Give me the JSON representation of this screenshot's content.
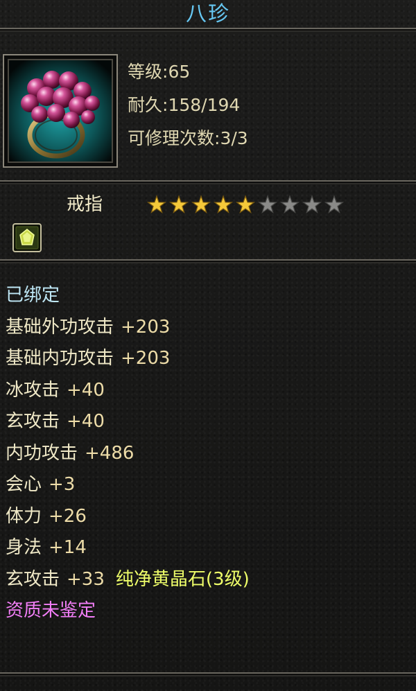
{
  "item": {
    "name": "八珍",
    "icon": "ring-icon",
    "level_label": "等级",
    "level_value": "65",
    "durability_label": "耐久",
    "durability_value": "158/194",
    "repair_label": "可修理次数",
    "repair_value": "3/3",
    "type": "戒指",
    "stars": {
      "filled": 5,
      "total": 9
    },
    "star_colors": {
      "filled": "#f5c93a",
      "empty": "#8a8a88"
    },
    "socket_icon": "gem-socket-icon"
  },
  "properties": {
    "bound": "已绑定",
    "lines": [
      {
        "name": "基础外功攻击",
        "value": "+203"
      },
      {
        "name": "基础内功攻击",
        "value": "+203"
      },
      {
        "name": "冰攻击",
        "value": "+40"
      },
      {
        "name": "玄攻击",
        "value": "+40"
      },
      {
        "name": "内功攻击",
        "value": "+486"
      },
      {
        "name": "会心",
        "value": "+3"
      },
      {
        "name": "体力",
        "value": "+26"
      },
      {
        "name": "身法",
        "value": "+14"
      }
    ],
    "gem_line": {
      "name": "玄攻击",
      "value": "+33",
      "gem": "纯净黄晶石(3级)"
    },
    "identify": "资质未鉴定"
  },
  "colors": {
    "title": "#66c7f2",
    "bound": "#bfe8f6",
    "gem": "#eefd69",
    "identify": "#f27ef7"
  }
}
